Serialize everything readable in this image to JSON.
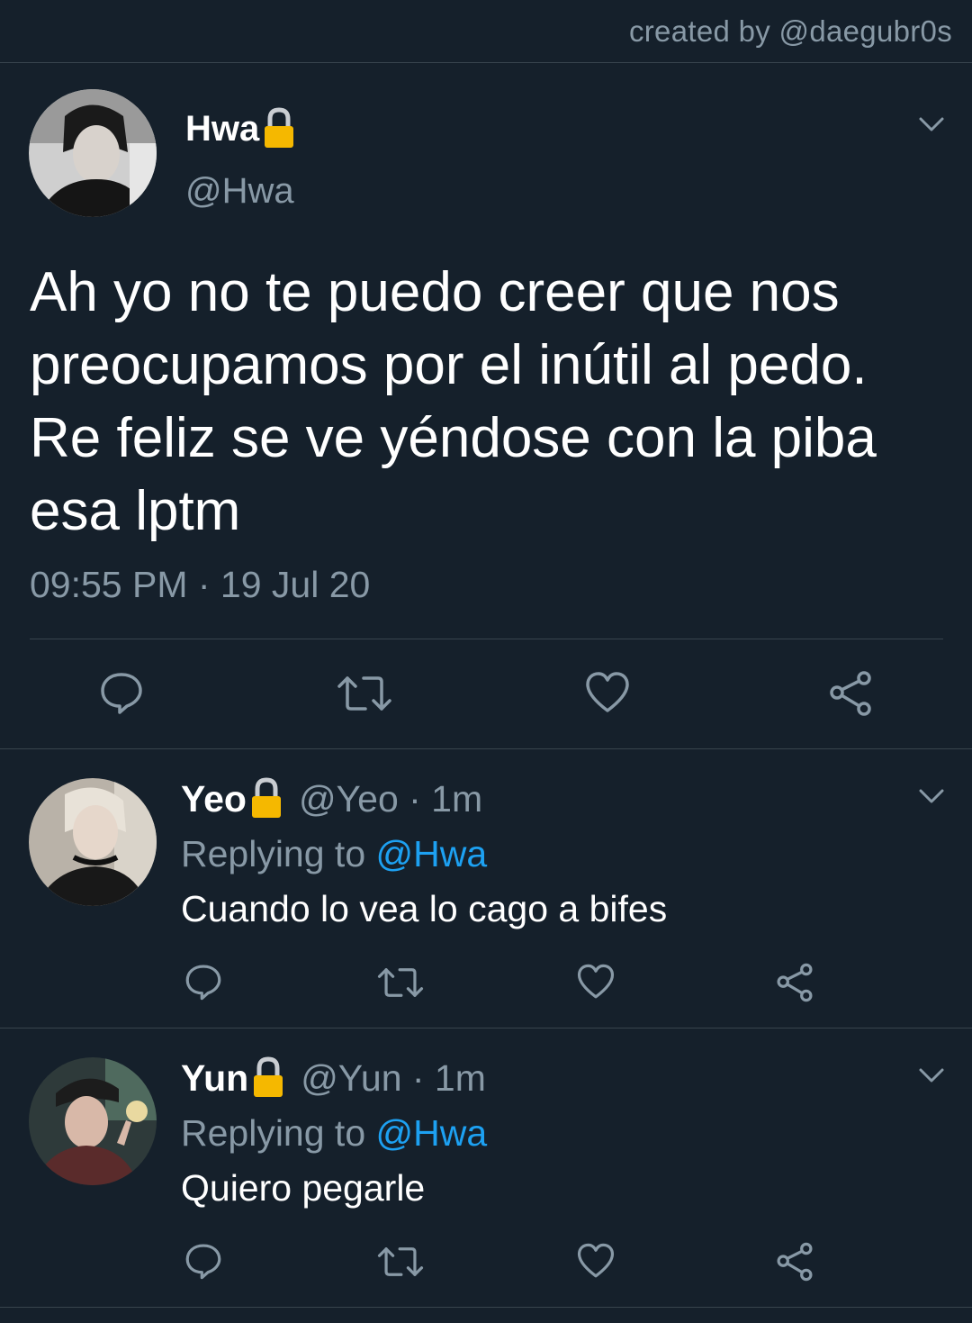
{
  "header": {
    "credit": "created by @daegubr0s"
  },
  "main_tweet": {
    "name": "Hwa",
    "handle": "@Hwa",
    "text": "Ah yo no te puedo creer que nos preocupamos por el inútil al pedo. Re feliz se ve yéndose con la piba esa lptm",
    "timestamp": "09:55 PM · 19 Jul 20",
    "avatar_icon": "avatar-photo",
    "lock_icon": "lock-icon"
  },
  "replies": [
    {
      "name": "Yeo",
      "handle": "@Yeo · 1m",
      "replying_prefix": "Replying to",
      "replying_mention": "@Hwa",
      "text": "Cuando lo vea lo cago a bifes"
    },
    {
      "name": "Yun",
      "handle": "@Yun · 1m",
      "replying_prefix": "Replying to",
      "replying_mention": "@Hwa",
      "text": "Quiero pegarle"
    }
  ],
  "colors": {
    "background": "#15202b",
    "muted": "#8899a6",
    "accent": "#1da1f2",
    "divider": "#38444d",
    "lock": "#f5b800"
  },
  "icons": [
    "reply-icon",
    "retweet-icon",
    "like-icon",
    "share-icon",
    "chevron-down-icon",
    "lock-icon"
  ]
}
